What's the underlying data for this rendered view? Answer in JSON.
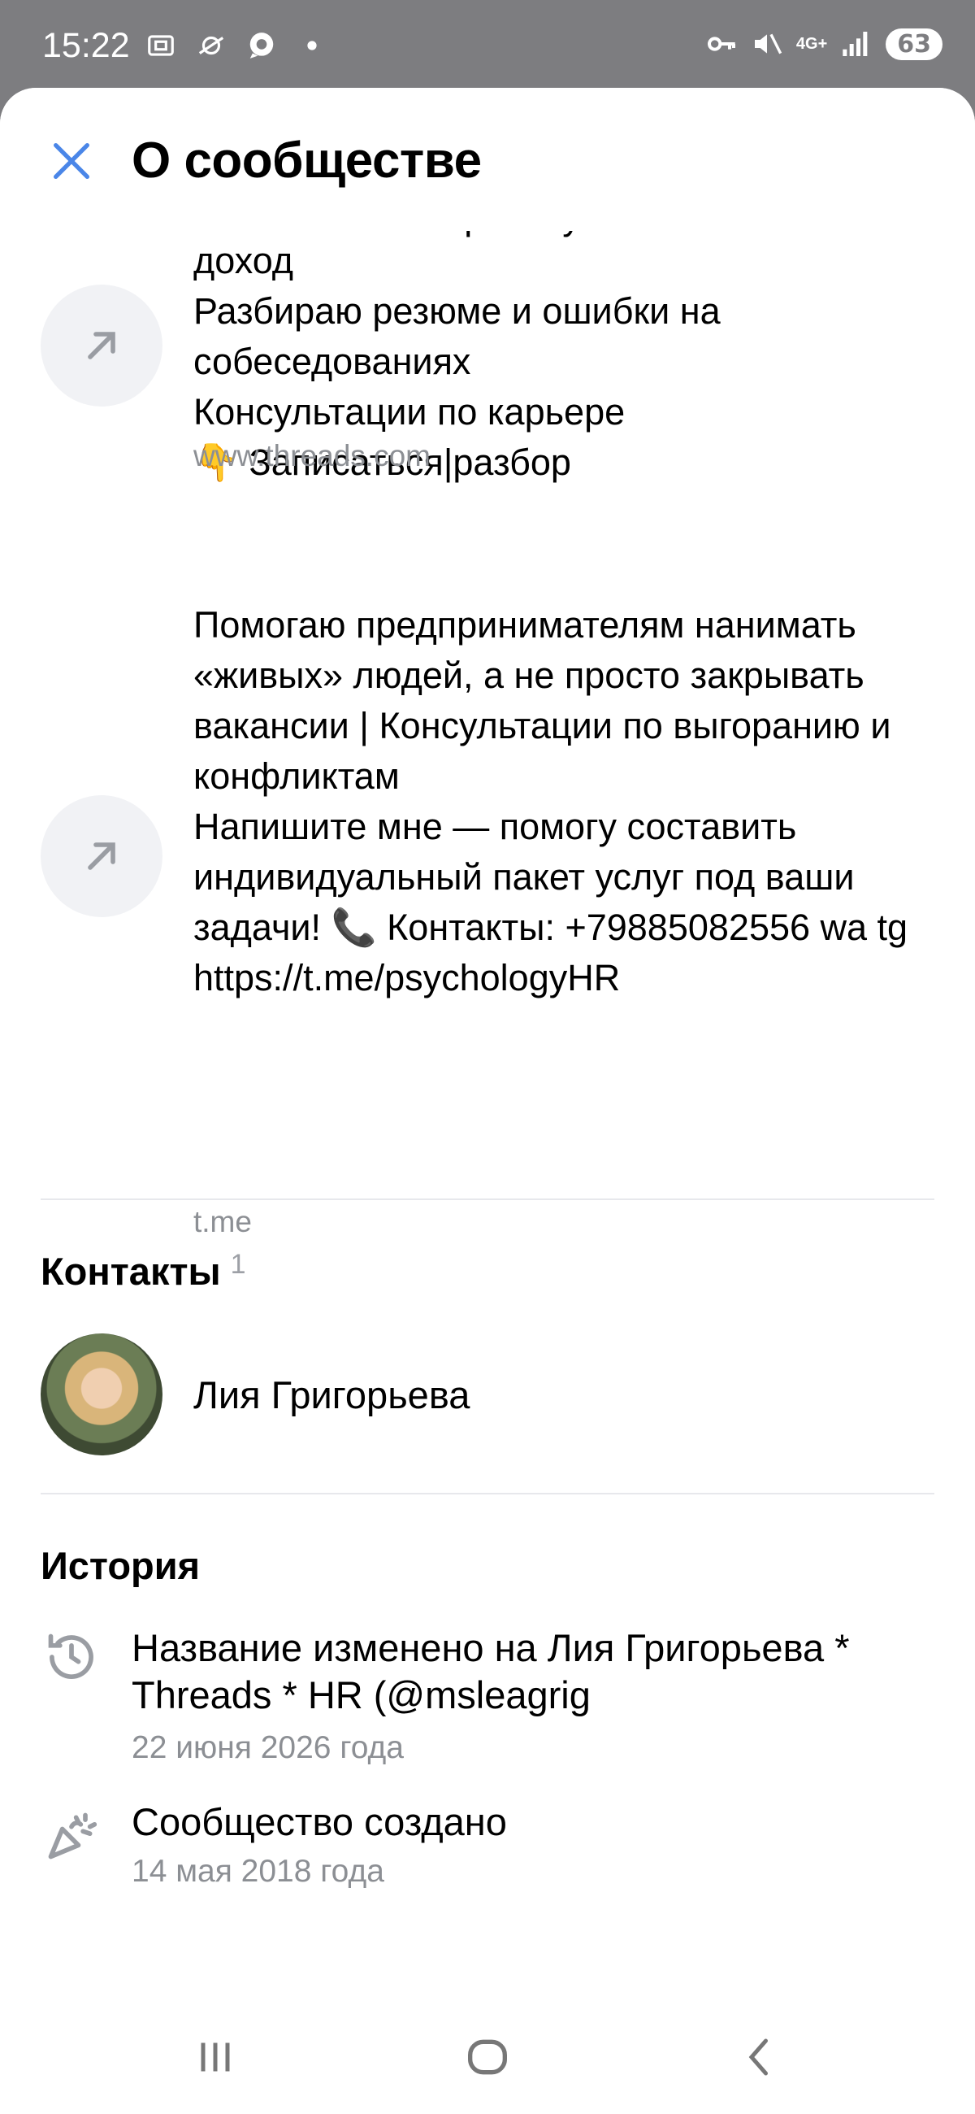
{
  "status_bar": {
    "time": "15:22",
    "network": "4G+",
    "battery": "63",
    "left_icons": [
      "screenshot-icon",
      "data-saver-icon",
      "chat-bubble-icon",
      "dot-icon"
    ],
    "right_icons": [
      "key-icon",
      "mute-icon",
      "network-4g-icon",
      "signal-icon",
      "battery-icon"
    ]
  },
  "header": {
    "title": "О сообществе",
    "close_icon": "close-icon",
    "accent_color": "#4a86e8"
  },
  "links": [
    {
      "text_partial_top": "Помогаю найти работу и повысить",
      "text": "доход\nРазбираю резюме и ошибки на собеседованиях\nКонсультации по карьере\n👇 Записаться|разбор",
      "domain": "www.threads.com"
    },
    {
      "text": "Помогаю предпринимателям нанимать «живых» людей, а не просто закрывать вакансии | Консультации по выгоранию и конфликтам\nНапишите мне — помогу составить индивидуальный пакет услуг под ваши задачи! 📞 Контакты: +79885082556 wa tg https://t.me/psychologyHR",
      "domain": "t.me"
    }
  ],
  "contacts": {
    "title": "Контакты",
    "count": "1",
    "items": [
      {
        "name": "Лия Григорьева"
      }
    ]
  },
  "history": {
    "title": "История",
    "items": [
      {
        "icon": "history-clock-icon",
        "title": "Название изменено на Лия Григорьева * Threads * HR (@msleagrig",
        "date": "22 июня 2026 года"
      },
      {
        "icon": "party-popper-icon",
        "title": "Сообщество создано",
        "date": "14 мая 2018 года"
      }
    ]
  },
  "nav_bar": {
    "buttons": [
      "recent-apps",
      "home",
      "back"
    ]
  }
}
